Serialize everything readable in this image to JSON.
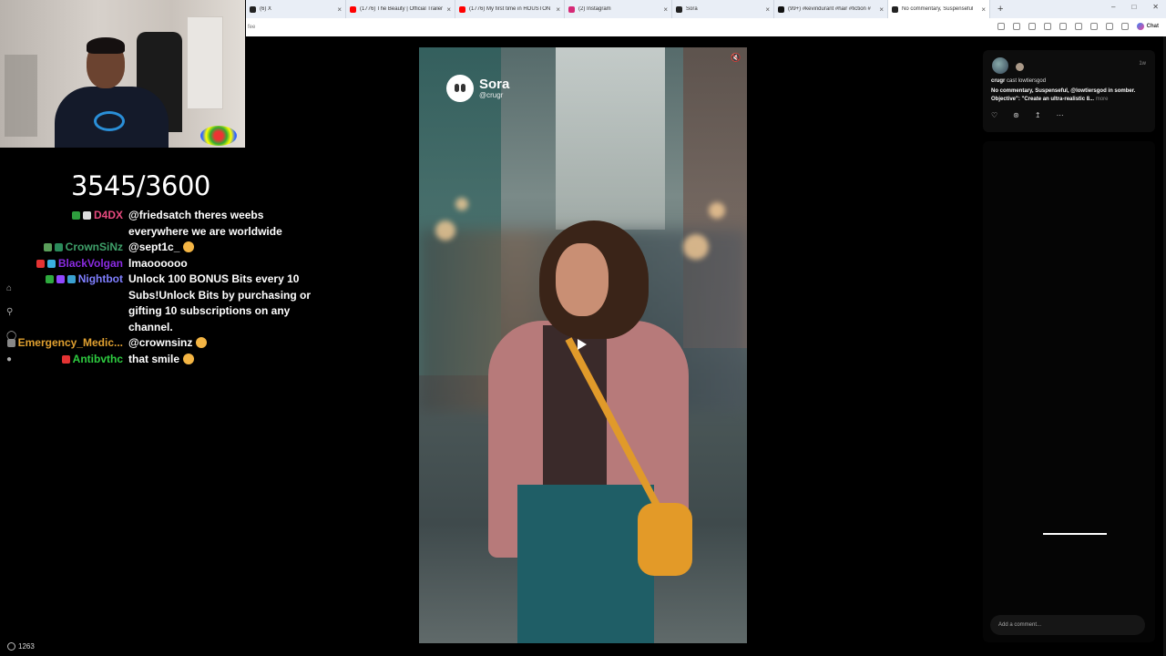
{
  "browser": {
    "tabs": [
      {
        "title": "(6) X",
        "color": "#222222",
        "active": false
      },
      {
        "title": "(1776) The Beauty | Official Trailer",
        "color": "#ff0000",
        "active": false
      },
      {
        "title": "(1776) My first time in HOUSTON",
        "color": "#ff0000",
        "active": false
      },
      {
        "title": "(2) Instagram",
        "color": "#d62976",
        "active": false
      },
      {
        "title": "Sora",
        "color": "#222222",
        "active": false
      },
      {
        "title": "(99+) #kevindurant #hair #fiction #",
        "color": "#111111",
        "active": false
      },
      {
        "title": "No commentary, Suspenseful",
        "color": "#222222",
        "active": true
      }
    ],
    "new_tab": "+",
    "address_text": "fee",
    "chat_label": "Chat"
  },
  "stream": {
    "counter": "3545/3600",
    "viewer_count": "1263",
    "chat": [
      {
        "name": "D4DX",
        "name_color": "#e84a7f",
        "text": "@friedsatch theres weebs everywhere we are worldwide",
        "badges": [
          "#2e9e3e",
          "#dddddd"
        ],
        "emote": false
      },
      {
        "name": "CrownSiNz",
        "name_color": "#3fa06a",
        "text": "@sept1c_",
        "badges": [
          "#5a9e5a",
          "#2a8a5a"
        ],
        "emote": true
      },
      {
        "name": "BlackVolgan",
        "name_color": "#8a2be2",
        "text": "lmaoooooo",
        "badges": [
          "#e33333",
          "#3ab0e0"
        ],
        "emote": false
      },
      {
        "name": "Nightbot",
        "name_color": "#7f7fff",
        "text": "Unlock 100 BONUS Bits every 10 Subs!Unlock Bits by purchasing or gifting 10 subscriptions on any channel.",
        "badges": [
          "#2eaa3e",
          "#9147ff",
          "#3aa0d0"
        ],
        "emote": false
      },
      {
        "name": "Emergency_Medic...",
        "name_color": "#e0a030",
        "text": "@crownsinz",
        "badges": [
          "#888888"
        ],
        "emote": true
      },
      {
        "name": "Antibvthc",
        "name_color": "#2ecc40",
        "text": "that smile",
        "badges": [
          "#e33333"
        ],
        "emote": true
      }
    ]
  },
  "video": {
    "brand": "Sora",
    "handle": "@crugr"
  },
  "post": {
    "time": "1w",
    "author": "crugr",
    "cast_text": "cast lowtiersgod",
    "caption": "No commentary, Suspenseful, @lowtiersgod in somber. Objective\": \"Create an ultra-realistic 8...",
    "more": "more",
    "comment_placeholder": "Add a comment..."
  },
  "icons": [
    "home-icon",
    "search-icon",
    "bell-icon",
    "heart-icon",
    "remix-icon",
    "share-icon",
    "more-icon",
    "mute-icon",
    "play-icon"
  ]
}
